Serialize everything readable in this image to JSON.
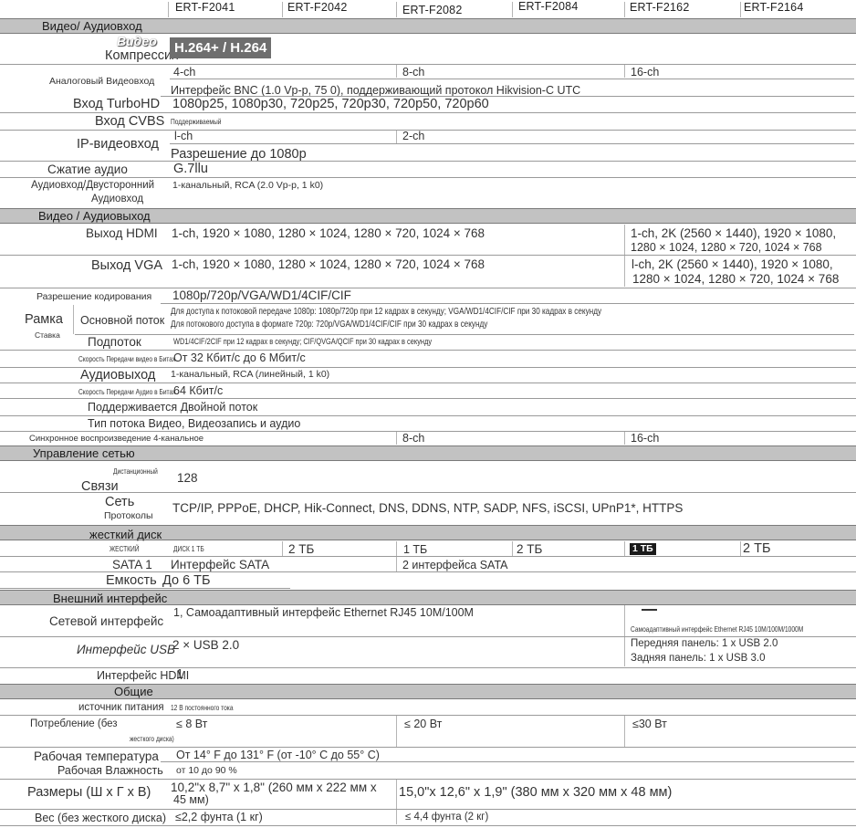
{
  "header": {
    "models": [
      "ERT-F2041",
      "ERT-F2042",
      "ERT-F2082",
      "ERT-F2084",
      "ERT-F2162",
      "ERT-F2164"
    ]
  },
  "sections": {
    "video_audio_in": "Видео/ Аудиовход",
    "video_audio_out": "Видео / Аудиовыход",
    "network": "Управление сетью",
    "hdd": "жесткий диск",
    "external": "Внешний интерфейс",
    "general": "Общие"
  },
  "video_in": {
    "compression_label": "Компрессия",
    "compression_overlay": "Видео",
    "compression_value": "H.264+ / H.264",
    "analog_label": "Аналоговый Видеовход",
    "analog_v1": "4-ch",
    "analog_v2": "8-ch",
    "analog_v3": "16-ch",
    "turbo_interface": "Интерфейс BNC (1.0 Vp-p, 75 0), поддерживающий протокол Hikvision-C UTC",
    "turbo_label": "Вход TurboHD",
    "turbo_value": "1080p25, 1080p30, 720p25, 720p30, 720p50, 720p60",
    "cvbs_label": "Вход CVBS",
    "cvbs_value": "Поддерживаемый",
    "ip_label": "IP-видеовход",
    "ip_v1": "l-ch",
    "ip_v2": "2-ch",
    "ip_res": "Разрешение до 1080p",
    "audio_comp_label": "Сжатие аудио",
    "audio_comp_value": "G.7llu",
    "audio_in_label_1": "Аудиовход/Двусторонний",
    "audio_in_label_2": "Аудиовход",
    "audio_in_value": "1-канальный, RCA (2.0 Vp-p, 1 k0)"
  },
  "video_out": {
    "hdmi_label": "Выход HDMI",
    "hdmi_v1": "1-ch, 1920 × 1080, 1280 × 1024, 1280 × 720, 1024 × 768",
    "hdmi_v2a": "1-ch, 2K (2560 × 1440), 1920 × 1080,",
    "hdmi_v2b": "1280 × 1024, 1280 × 720, 1024 × 768",
    "vga_label": "Выход VGA",
    "vga_v1": "1-ch, 1920 × 1080, 1280 × 1024, 1280 × 720, 1024 × 768",
    "vga_v2a": "l-ch, 2K (2560 × 1440), 1920 × 1080,",
    "vga_v2b": "1280 × 1024, 1280 × 720, 1024 × 768",
    "enc_res_label": "Разрешение кодирования",
    "enc_res_value": "1080p/720p/VGA/WD1/4CIF/CIF",
    "frame_label": "Рамка",
    "rate_label": "Ставка",
    "main_stream_label": "Основной поток",
    "main_stream_1": "Для доступа к потоковой передаче 1080p: 1080p/720p при 12 кадрах в секунду; VGA/WD1/4CIF/CIF при 30 кадрах в секунду",
    "main_stream_2": "Для потокового доступа в формате 720p: 720p/VGA/WD1/4CIF/CIF при 30 кадрах в секунду",
    "sub_stream_label": "Подпоток",
    "sub_stream_value": "WD1/4CIF/2CIF при 12 кадрах в секунду; CIF/QVGA/QCIF при 30 кадрах в секунду",
    "video_bitrate_label": "Скорость Передачи видео в Битах",
    "video_bitrate_value": "От 32 Кбит/с до 6 Мбит/с",
    "audio_out_label": "Аудиовыход",
    "audio_out_value": "1-канальный, RCA (линейный, 1 k0)",
    "audio_bitrate_label": "Скорость Передачи Аудио в Битах",
    "audio_bitrate_value": "64 Кбит/с",
    "dual_stream": "Поддерживается Двойной поток",
    "stream_type": "Тип потока Видео, Видеозапись и аудио",
    "sync_label": "Синхронное воспроизведение 4-канальное",
    "sync_v2": "8-ch",
    "sync_v3": "16-ch"
  },
  "network": {
    "remote_label": "Дистанционный",
    "remote_value": "128",
    "conn_label": "Связи",
    "net_label": "Сеть",
    "protocols_label": "Протоколы",
    "protocols_value": "TCP/IP, PPPoE, DHCP, Hik-Connect, DNS, DDNS, NTP, SADP, NFS, iSCSI, UPnP1*, HTTPS"
  },
  "hdd": {
    "small_label": "ЖЕСТКИЙ",
    "small_value": "ДИСК 1 ТБ",
    "cap": [
      "2 ТБ",
      "1 ТБ",
      "2 ТБ",
      "1 ТБ",
      "2 ТБ"
    ],
    "sata_label": "SATA 1",
    "sata_v1": "Интерфейс SATA",
    "sata_v2": "2 интерфейса SATA",
    "capacity_label": "Емкость",
    "capacity_value": "До 6 ТБ"
  },
  "external": {
    "net_if_label": "Сетевой интерфейс",
    "net_if_v1": "1, Самоадаптивный интерфейс Ethernet RJ45 10M/100M",
    "net_if_v2": "Самоадаптивный интерфейс Ethernet RJ45 10M/100M/1000M",
    "usb_label": "Интерфейс USB",
    "usb_v1": "2 × USB 2.0",
    "usb_front": "Передняя панель: 1 x USB 2.0",
    "usb_rear": "Задняя панель: 1 x USB 3.0",
    "hdmi_label": "Интерфейс HDMI",
    "hdmi_value": "1"
  },
  "general": {
    "power_label": "источник питания",
    "power_value": "12 В постоянного тока",
    "consumption_label": "Потребление (без",
    "consumption_sub": "жесткого диска)",
    "cons_v1": "≤ 8 Вт",
    "cons_v2": "≤ 20 Вт",
    "cons_v3": "≤30 Вт",
    "temp_label": "Рабочая температура",
    "temp_value": "От 14° F до 131° F (от -10° C до 55° C)",
    "humidity_label": "Рабочая Влажность",
    "humidity_value": "от 10 до 90 %",
    "dims_label": "Размеры (Ш x Г x В)",
    "dims_v1a": "10,2\"x 8,7\" x 1,8\" (260 мм x 222 мм x",
    "dims_v1b": "45 мм)",
    "dims_v2": "15,0\"x 12,6\" x 1,9\" (380 мм x 320 мм x 48 мм)",
    "weight_label": "Вес (без жесткого диска)",
    "weight_v1": "≤2,2 фунта (1 кг)",
    "weight_v2": "≤ 4,4 фунта (2 кг)"
  }
}
